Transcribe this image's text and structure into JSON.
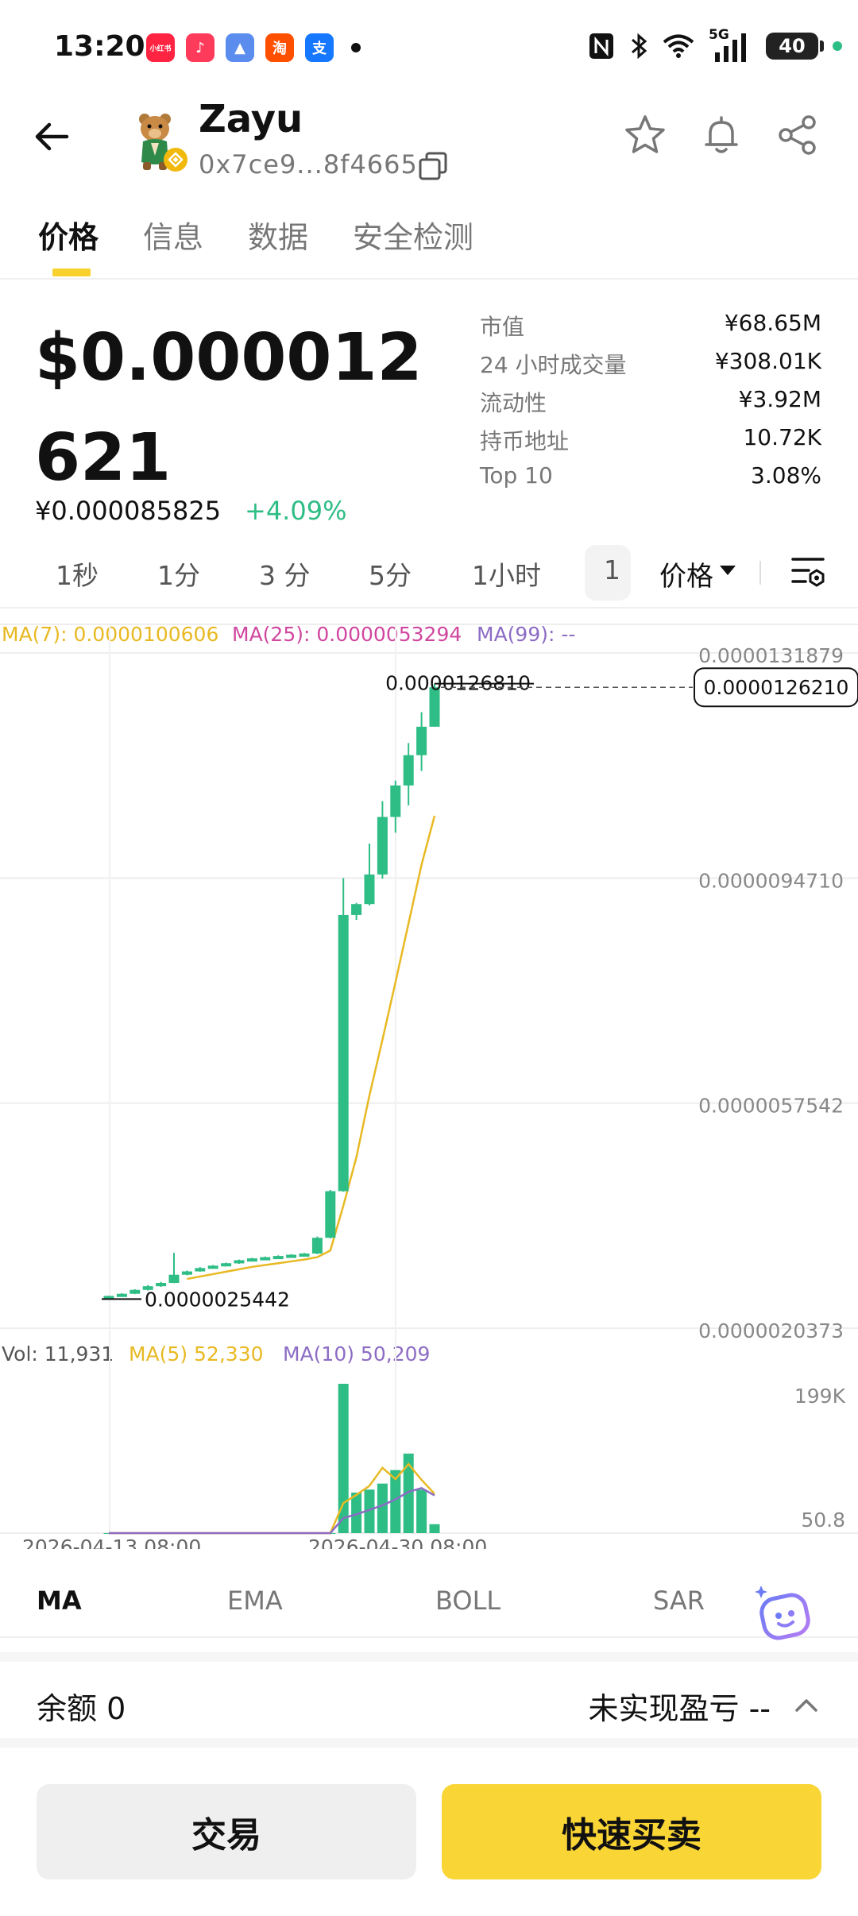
{
  "status_bar": {
    "time": "13:20",
    "apps": [
      {
        "name": "xiaohongshu-icon",
        "label": "小红书",
        "color": "#ff2442"
      },
      {
        "name": "music-icon",
        "label": "♪",
        "color": "#ff3b5c"
      },
      {
        "name": "maps-icon",
        "label": "▲",
        "color": "#5a8dee"
      },
      {
        "name": "taobao-icon",
        "label": "淘",
        "color": "#ff5000"
      },
      {
        "name": "alipay-icon",
        "label": "支",
        "color": "#1677ff"
      }
    ],
    "network": "5G",
    "battery": "40"
  },
  "header": {
    "token_name": "Zayu",
    "address": "0x7ce9...8f4665"
  },
  "tabs": [
    "价格",
    "信息",
    "数据",
    "安全检测"
  ],
  "price": {
    "main": "$0.000012621",
    "fiat": "¥0.000085825",
    "change": "+4.09%"
  },
  "stats": [
    {
      "label": "市值",
      "value": "¥68.65M"
    },
    {
      "label": "24 小时成交量",
      "value": "¥308.01K"
    },
    {
      "label": "流动性",
      "value": "¥3.92M"
    },
    {
      "label": "持币地址",
      "value": "10.72K"
    },
    {
      "label": "Top 10",
      "value": "3.08%"
    }
  ],
  "intervals": [
    "1秒",
    "1分",
    "3 分",
    "5分",
    "1小时"
  ],
  "interval_active": "1",
  "price_dropdown": "价格",
  "ma_legend": {
    "ma7": "MA(7): 0.0000100606",
    "ma25": "MA(25): 0.0000053294",
    "ma99": "MA(99): --"
  },
  "vol_legend": {
    "vol": "Vol: 11,931",
    "ma5": "MA(5) 52,330",
    "ma10": "MA(10) 50,209"
  },
  "colors": {
    "up": "#2ebd85",
    "ma7": "#e8b923",
    "ma25": "#d0479f",
    "ma99": "#8c6cc4",
    "accent": "#f8d12f"
  },
  "chart_data": {
    "type": "candlestick",
    "y_axis_labels": [
      "0.0000131879",
      "0.0000094710",
      "0.0000057542",
      "0.0000020373"
    ],
    "ylim": [
      2.0373e-06,
      1.31879e-05
    ],
    "x_axis_labels": [
      "2026-04-13 08:00",
      "2026-04-30 08:00"
    ],
    "high_label": "0.0000126810",
    "low_label": "0.0000025442",
    "current_price_label": "0.0000126210",
    "candles": [
      {
        "o": 2.5442e-06,
        "h": 2.575e-06,
        "l": 2.5442e-06,
        "c": 2.57e-06
      },
      {
        "o": 2.57e-06,
        "h": 2.615e-06,
        "l": 2.56e-06,
        "c": 2.605e-06
      },
      {
        "o": 2.605e-06,
        "h": 2.68e-06,
        "l": 2.6e-06,
        "c": 2.67e-06
      },
      {
        "o": 2.67e-06,
        "h": 2.75e-06,
        "l": 2.66e-06,
        "c": 2.73e-06
      },
      {
        "o": 2.73e-06,
        "h": 2.8e-06,
        "l": 2.72e-06,
        "c": 2.785e-06
      },
      {
        "o": 2.785e-06,
        "h": 3.28e-06,
        "l": 2.78e-06,
        "c": 2.92e-06
      },
      {
        "o": 2.92e-06,
        "h": 2.99e-06,
        "l": 2.91e-06,
        "c": 2.975e-06
      },
      {
        "o": 2.975e-06,
        "h": 3.045e-06,
        "l": 2.97e-06,
        "c": 3.03e-06
      },
      {
        "o": 3.03e-06,
        "h": 3.08e-06,
        "l": 3.02e-06,
        "c": 3.07e-06
      },
      {
        "o": 3.07e-06,
        "h": 3.12e-06,
        "l": 3.06e-06,
        "c": 3.11e-06
      },
      {
        "o": 3.11e-06,
        "h": 3.17e-06,
        "l": 3.1e-06,
        "c": 3.16e-06
      },
      {
        "o": 3.16e-06,
        "h": 3.2e-06,
        "l": 3.15e-06,
        "c": 3.19e-06
      },
      {
        "o": 3.19e-06,
        "h": 3.22e-06,
        "l": 3.18e-06,
        "c": 3.21e-06
      },
      {
        "o": 3.21e-06,
        "h": 3.24e-06,
        "l": 3.2e-06,
        "c": 3.23e-06
      },
      {
        "o": 3.23e-06,
        "h": 3.26e-06,
        "l": 3.22e-06,
        "c": 3.25e-06
      },
      {
        "o": 3.25e-06,
        "h": 3.28e-06,
        "l": 3.24e-06,
        "c": 3.27e-06
      },
      {
        "o": 3.27e-06,
        "h": 3.55e-06,
        "l": 3.26e-06,
        "c": 3.53e-06
      },
      {
        "o": 3.53e-06,
        "h": 4.32e-06,
        "l": 3.52e-06,
        "c": 4.3e-06
      },
      {
        "o": 4.3e-06,
        "h": 9.47e-06,
        "l": 4.29e-06,
        "c": 8.86e-06
      },
      {
        "o": 8.86e-06,
        "h": 9.06e-06,
        "l": 8.78e-06,
        "c": 9.04e-06
      },
      {
        "o": 9.04e-06,
        "h": 1.004e-05,
        "l": 9.02e-06,
        "c": 9.53e-06
      },
      {
        "o": 9.53e-06,
        "h": 1.074e-05,
        "l": 9.46e-06,
        "c": 1.048e-05
      },
      {
        "o": 1.048e-05,
        "h": 1.108e-05,
        "l": 1.022e-05,
        "c": 1.1e-05
      },
      {
        "o": 1.1e-05,
        "h": 1.17e-05,
        "l": 1.067e-05,
        "c": 1.15e-05
      },
      {
        "o": 1.15e-05,
        "h": 1.221e-05,
        "l": 1.124e-05,
        "c": 1.197e-05
      },
      {
        "o": 1.197e-05,
        "h": 1.2681e-05,
        "l": 1.197e-05,
        "c": 1.2621e-05
      }
    ],
    "ma7": [
      null,
      null,
      null,
      null,
      null,
      null,
      2.85e-06,
      2.89e-06,
      2.93e-06,
      2.97e-06,
      3.01e-06,
      3.05e-06,
      3.08e-06,
      3.11e-06,
      3.14e-06,
      3.17e-06,
      3.21e-06,
      3.32e-06,
      4.06e-06,
      4.86e-06,
      5.88e-06,
      6.8e-06,
      7.75e-06,
      8.72e-06,
      9.69e-06,
      1.05e-05
    ],
    "volume": {
      "ylim": [
        0,
        199000
      ],
      "axis_labels": [
        "199K",
        "50.8"
      ],
      "bars": [
        51,
        60,
        55,
        62,
        58,
        80,
        65,
        60,
        63,
        58,
        61,
        64,
        60,
        66,
        70,
        68,
        55,
        60,
        199000,
        54000,
        58000,
        66000,
        84000,
        106000,
        58000,
        11931
      ],
      "ma5": [
        51,
        55,
        57,
        58,
        58,
        62,
        63,
        62,
        61,
        60,
        61,
        61,
        60,
        62,
        63,
        65,
        63,
        63,
        40000,
        51000,
        63000,
        87000,
        72000,
        92000,
        71000,
        52330
      ],
      "ma10": [
        51,
        55,
        57,
        58,
        58,
        60,
        61,
        61,
        61,
        61,
        61,
        61,
        61,
        61,
        62,
        62,
        62,
        62,
        20000,
        25000,
        31000,
        37000,
        45000,
        55000,
        60000,
        50209
      ]
    }
  },
  "indicators": [
    "MA",
    "EMA",
    "BOLL",
    "SAR"
  ],
  "balance": {
    "label": "余额 0",
    "pnl": "未实现盈亏 --"
  },
  "buttons": {
    "trade": "交易",
    "quick": "快速买卖"
  }
}
